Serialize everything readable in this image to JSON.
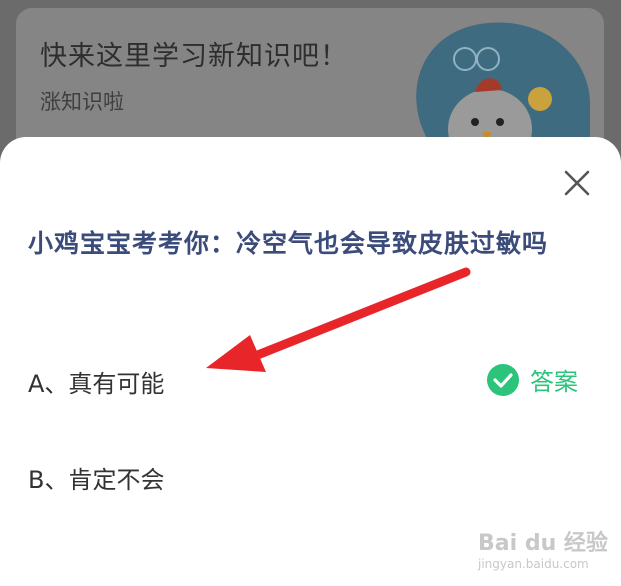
{
  "banner": {
    "title": "快来这里学习新知识吧！",
    "subtitle": "涨知识啦"
  },
  "quiz": {
    "question": "小鸡宝宝考考你：冷空气也会导致皮肤过敏吗",
    "options": [
      {
        "label": "A、真有可能",
        "correct": true
      },
      {
        "label": "B、肯定不会",
        "correct": false
      }
    ],
    "answer_label": "答案",
    "answer_icon": "check-circle-icon",
    "close_icon": "close-icon"
  },
  "colors": {
    "question_text": "#3b4b7a",
    "answer_green": "#2bc47a",
    "arrow_red": "#e8262a"
  },
  "watermark": {
    "brand": "Bai du 经验",
    "url": "jingyan.baidu.com"
  }
}
